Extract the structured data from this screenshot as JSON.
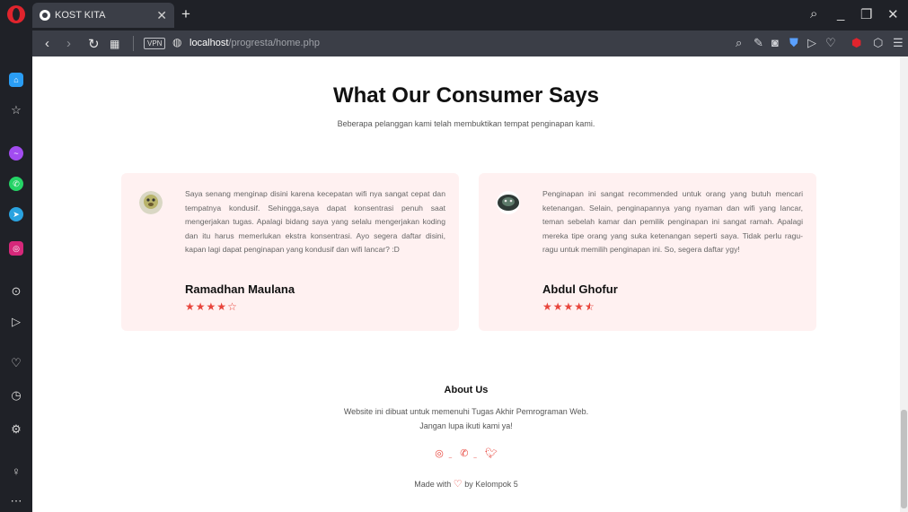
{
  "browser": {
    "tab_title": "KOST KITA",
    "vpn_label": "VPN",
    "url_host": "localhost",
    "url_path": "/progresta/home.php"
  },
  "testimonials": {
    "title": "What Our Consumer Says",
    "subtitle": "Beberapa pelanggan kami telah membuktikan tempat penginapan kami.",
    "items": [
      {
        "quote": "Saya senang menginap disini karena kecepatan wifi nya sangat cepat dan tempatnya kondusif. Sehingga,saya dapat konsentrasi penuh saat mengerjakan tugas. Apalagi bidang saya yang selalu mengerjakan koding dan itu harus memerlukan ekstra konsentrasi. Ayo segera daftar disini, kapan lagi dapat penginapan yang kondusif dan wifi lancar? :D",
        "name": "Ramadhan Maulana",
        "rating": 4
      },
      {
        "quote": "Penginapan ini sangat recommended untuk orang yang butuh mencari ketenangan. Selain, penginapannya yang nyaman dan wifi yang lancar, teman sebelah kamar dan pemilik penginapan ini sangat ramah. Apalagi mereka tipe orang yang suka ketenangan seperti saya. Tidak perlu ragu-ragu untuk memilih penginapan ini. So, segera daftar ygy!",
        "name": "Abdul Ghofur",
        "rating": 4.5
      }
    ]
  },
  "footer": {
    "about_title": "About Us",
    "about_line1": "Website ini dibuat untuk memenuhi Tugas Akhir Pemrograman Web.",
    "about_line2": "Jangan lupa ikuti kami ya!",
    "made_prefix": "Made with",
    "made_suffix": "by Kelompok 5"
  },
  "colors": {
    "accent": "#e8453c",
    "card_bg": "#fff1f1",
    "chrome_bg": "#1f2127",
    "addressbar_bg": "#3b3e47"
  }
}
